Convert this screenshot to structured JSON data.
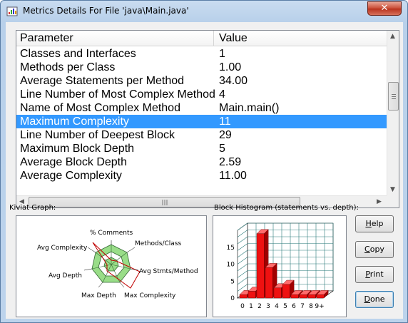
{
  "window": {
    "title": "Metrics Details For File 'java\\Main.java'",
    "close_glyph": "✕"
  },
  "table": {
    "columns": [
      "Parameter",
      "Value"
    ],
    "rows": [
      {
        "parameter": "Classes and Interfaces",
        "value": "1"
      },
      {
        "parameter": "Methods per Class",
        "value": "1.00"
      },
      {
        "parameter": "Average Statements per Method",
        "value": "34.00"
      },
      {
        "parameter": "Line Number of Most Complex Method",
        "value": "4"
      },
      {
        "parameter": "Name of Most Complex Method",
        "value": "Main.main()"
      },
      {
        "parameter": "Maximum Complexity",
        "value": "11"
      },
      {
        "parameter": "Line Number of Deepest Block",
        "value": "29"
      },
      {
        "parameter": "Maximum Block Depth",
        "value": "5"
      },
      {
        "parameter": "Average Block Depth",
        "value": "2.59"
      },
      {
        "parameter": "Average Complexity",
        "value": "11.00"
      }
    ],
    "selected_row": 5,
    "scroll_icons": {
      "up": "arrow-up-icon",
      "down": "arrow-down-icon",
      "left": "arrow-left-icon",
      "right": "arrow-right-icon"
    }
  },
  "kiviat": {
    "label": "Kiviat Graph:",
    "axes": [
      "% Comments",
      "Methods/Class",
      "Avg Stmts/Method",
      "Max Complexity",
      "Max Depth",
      "Avg Depth",
      "Avg Complexity"
    ],
    "colors": {
      "band": "#99dd88",
      "line": "#c00000"
    }
  },
  "histogram": {
    "label": "Block Histogram (statements vs. depth):",
    "chart_data": {
      "type": "bar",
      "categories": [
        "0",
        "1",
        "2",
        "3",
        "4",
        "5",
        "6",
        "7",
        "8",
        "9+"
      ],
      "values": [
        1,
        2,
        19,
        9,
        3,
        4,
        1,
        1,
        1,
        1
      ],
      "y_ticks": [
        "0",
        "5",
        "10",
        "15"
      ],
      "ylim": [
        0,
        20
      ],
      "grid": true,
      "bar_color": "#ee1111"
    }
  },
  "buttons": {
    "help": {
      "label": "Help",
      "hotkey": "H"
    },
    "copy": {
      "label": "Copy",
      "hotkey": "C"
    },
    "print": {
      "label": "Print",
      "hotkey": "P"
    },
    "done": {
      "label": "Done",
      "hotkey": "D"
    }
  }
}
